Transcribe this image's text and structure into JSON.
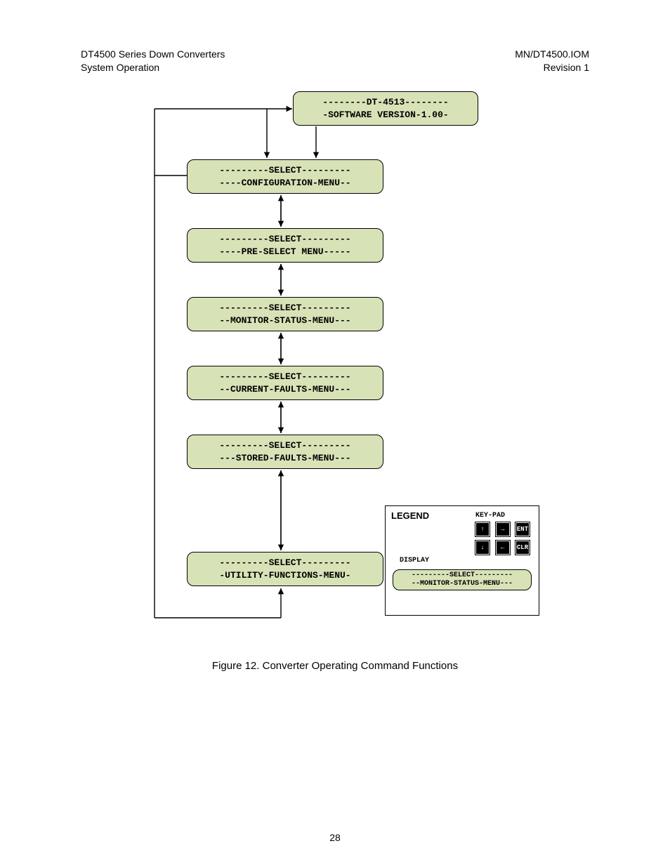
{
  "header": {
    "left_line1": "DT4500 Series Down Converters",
    "left_line2": "System Operation",
    "right_line1": "MN/DT4500.IOM",
    "right_line2": "Revision 1"
  },
  "top_box": {
    "line1": "--------DT-4513--------",
    "line2": "-SOFTWARE VERSION-1.00-"
  },
  "menus": [
    {
      "line1": "---------SELECT---------",
      "line2": "----CONFIGURATION-MENU--"
    },
    {
      "line1": "---------SELECT---------",
      "line2": "----PRE-SELECT MENU-----"
    },
    {
      "line1": "---------SELECT---------",
      "line2": "--MONITOR-STATUS-MENU---"
    },
    {
      "line1": "---------SELECT---------",
      "line2": "--CURRENT-FAULTS-MENU---"
    },
    {
      "line1": "---------SELECT---------",
      "line2": "---STORED-FAULTS-MENU---"
    },
    {
      "line1": "---------SELECT---------",
      "line2": "-UTILITY-FUNCTIONS-MENU-"
    }
  ],
  "legend": {
    "title": "LEGEND",
    "keypad_label": "KEY-PAD",
    "display_label": "DISPLAY",
    "keys_row1": [
      "↑",
      "→",
      "ENT"
    ],
    "keys_row2": [
      "↓",
      "←",
      "CLR"
    ],
    "display_box": {
      "line1": "---------SELECT---------",
      "line2": "--MONITOR-STATUS-MENU---"
    }
  },
  "figure_caption": "Figure 12.  Converter Operating Command Functions",
  "page_number": "28",
  "layout": {
    "menu_tops": [
      227,
      325,
      423,
      521,
      619,
      786
    ]
  }
}
